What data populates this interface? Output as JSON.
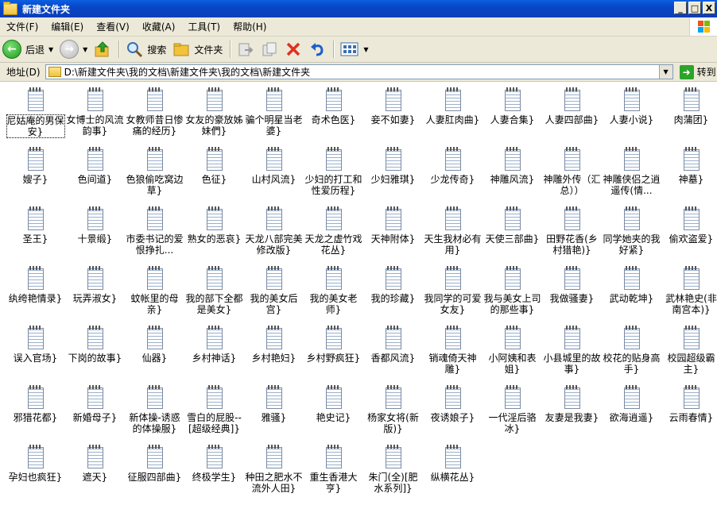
{
  "window": {
    "title": "新建文件夹",
    "minimize": "_",
    "maximize": "□",
    "close": "X"
  },
  "menu": [
    "文件(F)",
    "编辑(E)",
    "查看(V)",
    "收藏(A)",
    "工具(T)",
    "帮助(H)"
  ],
  "toolbar": {
    "back": "后退",
    "search": "搜索",
    "folders": "文件夹"
  },
  "address": {
    "label": "地址(D)",
    "path": "D:\\新建文件夹\\我的文档\\新建文件夹\\我的文档\\新建文件夹",
    "go": "转到"
  },
  "files": [
    "尼姑庵的男保安}",
    "女博士的风流韵事}",
    "女教师昔日惨痛的经历}",
    "女友的豪放姊妹們}",
    "骗个明星当老婆}",
    "奇术色医}",
    "妾不如妻}",
    "人妻肛肉曲}",
    "人妻合集}",
    "人妻四部曲}",
    "人妻小说}",
    "肉蒲团}",
    "嫂子}",
    "色间道}",
    "色狼偷吃窝边草}",
    "色征}",
    "山村风流}",
    "少妇的打工和性爱历程}",
    "少妇雅琪}",
    "少龙传奇}",
    "神雕风流}",
    "神雕外传（汇总））",
    "神雕侠侣之逍遥传(情...",
    "神墓}",
    "圣王}",
    "十景缎}",
    "市委书记的爱恨挣扎...",
    "熟女的恶哀}",
    "天龙八部完美修改版}",
    "天龙之虚竹戏花丛}",
    "天神附体}",
    "天生我材必有用}",
    "天使三部曲}",
    "田野花香(乡村猎艳)}",
    "同学她夹的我好紧}",
    "偷欢盗爱}",
    "纨绔艳情录}",
    "玩弄淑女}",
    "蚊帐里的母亲}",
    "我的部下全都是美女}",
    "我的美女后宫}",
    "我的美女老师}",
    "我的珍藏}",
    "我同学的可爱女友}",
    "我与美女上司的那些事}",
    "我做骚妻}",
    "武动乾坤}",
    "武林艳史(非南宫本)}",
    "误入官场}",
    "下岗的故事}",
    "仙器}",
    "乡村神话}",
    "乡村艳妇}",
    "乡村野疯狂}",
    "香都风流}",
    "销魂倚天神雕}",
    "小阿姨和表姐}",
    "小县城里的故事}",
    "校花的贴身高手}",
    "校园超级霸主}",
    "邪猎花都}",
    "新婚母子}",
    "新体操-诱惑的体操服}",
    "雪白的屁股--[超级经典]}",
    "雅骚}",
    "艳史记}",
    "杨家女将(新版)}",
    "夜诱娘子}",
    "一代淫后骆冰}",
    "友妻是我妻}",
    "欲海逍遥}",
    "云雨春情}",
    "孕妇也疯狂}",
    "遮天}",
    "征服四部曲}",
    "终极学生}",
    "种田之肥水不流外人田}",
    "重生香港大亨}",
    "朱门(全)[肥水系列]}",
    "纵横花丛}"
  ]
}
